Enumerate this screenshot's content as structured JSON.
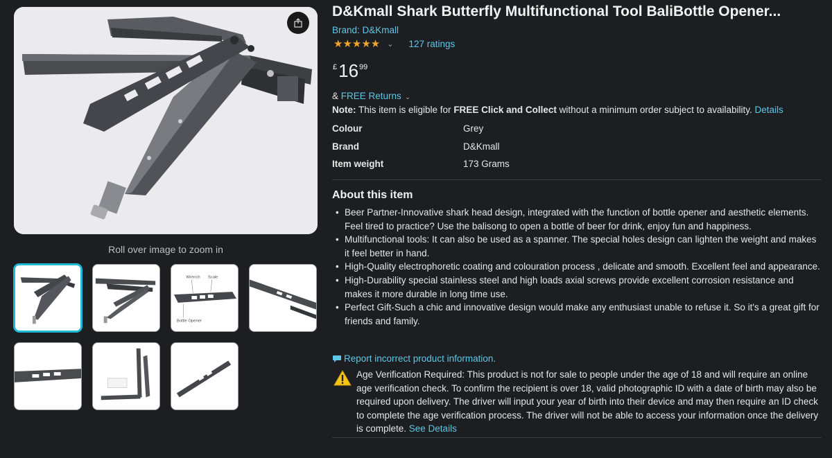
{
  "gallery": {
    "zoom_hint": "Roll over image to zoom in",
    "main_image_alt": "Butterfly multitool main image",
    "thumbnails": [
      {
        "name": "thumbnail-1",
        "selected": true
      },
      {
        "name": "thumbnail-2",
        "selected": false
      },
      {
        "name": "thumbnail-3",
        "selected": false
      },
      {
        "name": "thumbnail-4",
        "selected": false
      },
      {
        "name": "thumbnail-5",
        "selected": false
      },
      {
        "name": "thumbnail-6",
        "selected": false
      },
      {
        "name": "thumbnail-7",
        "selected": false
      }
    ]
  },
  "product": {
    "title": "D&Kmall Shark Butterfly Multifunctional Tool BaliBottle Opener...",
    "brand_link": "Brand: D&Kmall",
    "stars": "★★★★★",
    "rating_count": "127 ratings",
    "price": {
      "symbol": "£",
      "whole": "16",
      "fraction": "99"
    },
    "returns_prefix": "&",
    "returns_link": "FREE Returns",
    "note_label": "Note:",
    "note_text_1": " This item is eligible for ",
    "note_bold": "FREE Click and Collect",
    "note_text_2": " without a minimum order subject to availability. ",
    "note_link": "Details"
  },
  "specs": [
    {
      "key": "Colour",
      "value": "Grey"
    },
    {
      "key": "Brand",
      "value": "D&Kmall"
    },
    {
      "key": "Item weight",
      "value": "173 Grams"
    }
  ],
  "about": {
    "heading": "About this item",
    "bullets": [
      "Beer Partner-Innovative shark head design, integrated with the function of bottle opener and aesthetic elements. Feel tired to practice? Use the balisong to open a bottle of beer for drink, enjoy fun and happiness.",
      "Multifunctional tools: It can also be used as a spanner. The special holes design can lighten the weight and makes it feel better in hand.",
      "High-Quality electrophoretic coating and colouration process , delicate and smooth. Excellent feel and appearance.",
      "High-Durability special stainless steel and high loads axial screws provide excellent corrosion resistance and makes it more durable in long time use.",
      "Perfect Gift-Such a chic and innovative design would make any enthusiast unable to refuse it. So it's a great gift for friends and family."
    ]
  },
  "report_link": "Report incorrect product information.",
  "age_verification": {
    "text": "Age Verification Required: This product is not for sale to people under the age of 18 and will require an online age verification check. To confirm the recipient is over 18, valid photographic ID with a date of birth may also be required upon delivery. The driver will input your year of birth into their device and may then require an ID check to complete the age verification process. The driver will not be able to access your information once the delivery is complete. ",
    "link": "See Details"
  },
  "thumb_labels": {
    "wrench": "Wrench",
    "scale": "Scale",
    "bottle": "Bottle Opener"
  },
  "colors": {
    "background": "#1c1e21",
    "link": "#5ec8e8",
    "star": "#f0a42b",
    "selected_border": "#1dbad7",
    "warning": "#f5c518"
  }
}
